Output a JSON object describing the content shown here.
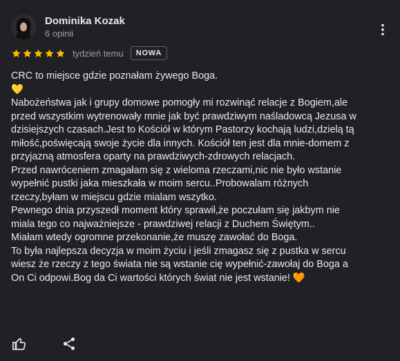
{
  "reviewer": {
    "name": "Dominika Kozak",
    "review_count": "6 opinii",
    "avatar_icon": "person-avatar"
  },
  "review": {
    "rating": 5,
    "date": "tydzień temu",
    "badge": "NOWA",
    "star_color": "#fbbc04",
    "lines": [
      "CRC to miejsce gdzie poznałam żywego Boga.",
      "💛",
      "Nabożeństwa jak i grupy domowe pomogły mi rozwinąć relacje z Bogiem,ale",
      "przed wszystkim wytrenowały mnie jak być prawdziwym naśladowcą Jezusa w",
      "dzisiejszych czasach.Jest to Kościół w którym Pastorzy kochają ludzi,dzielą tą",
      "miłość,poświęcają swoje życie dla innych. Kościół ten jest dla mnie-domem z",
      "przyjazną atmosfera oparty na prawdziwych-zdrowych relacjach.",
      "Przed nawróceniem zmagałam się z wieloma rzeczami,nic nie było wstanie",
      "wypełnić pustki jaka mieszkała w moim sercu..Probowalam różnych",
      "rzeczy,byłam w miejscu gdzie mialam wszytko.",
      "Pewnego dnia przyszedł moment który sprawił,że poczułam się jakbym nie",
      "miala tego co najważniejsze - prawdziwej relacji z Duchem Świętym..",
      "Miałam wtedy ogromne przekonanie,że muszę zawołać do Boga.",
      "To była najlepsza decyzja w moim życiu i jeśli zmagasz się z pustka w sercu",
      "wiesz że rzeczy z tego świata nie są wstanie cię wypełnić-zawołaj do Boga a",
      "On Ci odpowi.Bog da Ci wartości których świat nie jest wstanie! 🧡"
    ]
  },
  "actions": {
    "like_icon": "thumbs-up-icon",
    "share_icon": "share-icon",
    "more_icon": "more-vert-icon"
  }
}
